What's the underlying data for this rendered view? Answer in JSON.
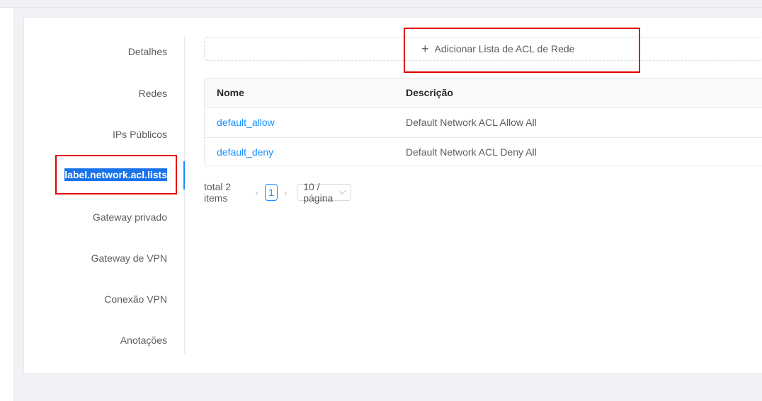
{
  "tabs": [
    {
      "label": "Detalhes"
    },
    {
      "label": "Redes"
    },
    {
      "label": "IPs Públicos"
    },
    {
      "label": "label.network.acl.lists"
    },
    {
      "label": "Gateway privado"
    },
    {
      "label": "Gateway de VPN"
    },
    {
      "label": "Conexão VPN"
    },
    {
      "label": "Anotações"
    }
  ],
  "add_button": {
    "icon": "plus-icon",
    "label": "Adicionar Lista de ACL de Rede"
  },
  "table": {
    "columns": [
      "Nome",
      "Descrição"
    ],
    "rows": [
      {
        "name": "default_allow",
        "description": "Default Network ACL Allow All"
      },
      {
        "name": "default_deny",
        "description": "Default Network ACL Deny All"
      }
    ]
  },
  "pagination": {
    "total": "total 2 items",
    "current_page": "1",
    "page_size": "10 / página"
  },
  "colors": {
    "accent": "#1890ff",
    "highlight_box": "#e00000",
    "selection": "#1a73e8"
  }
}
